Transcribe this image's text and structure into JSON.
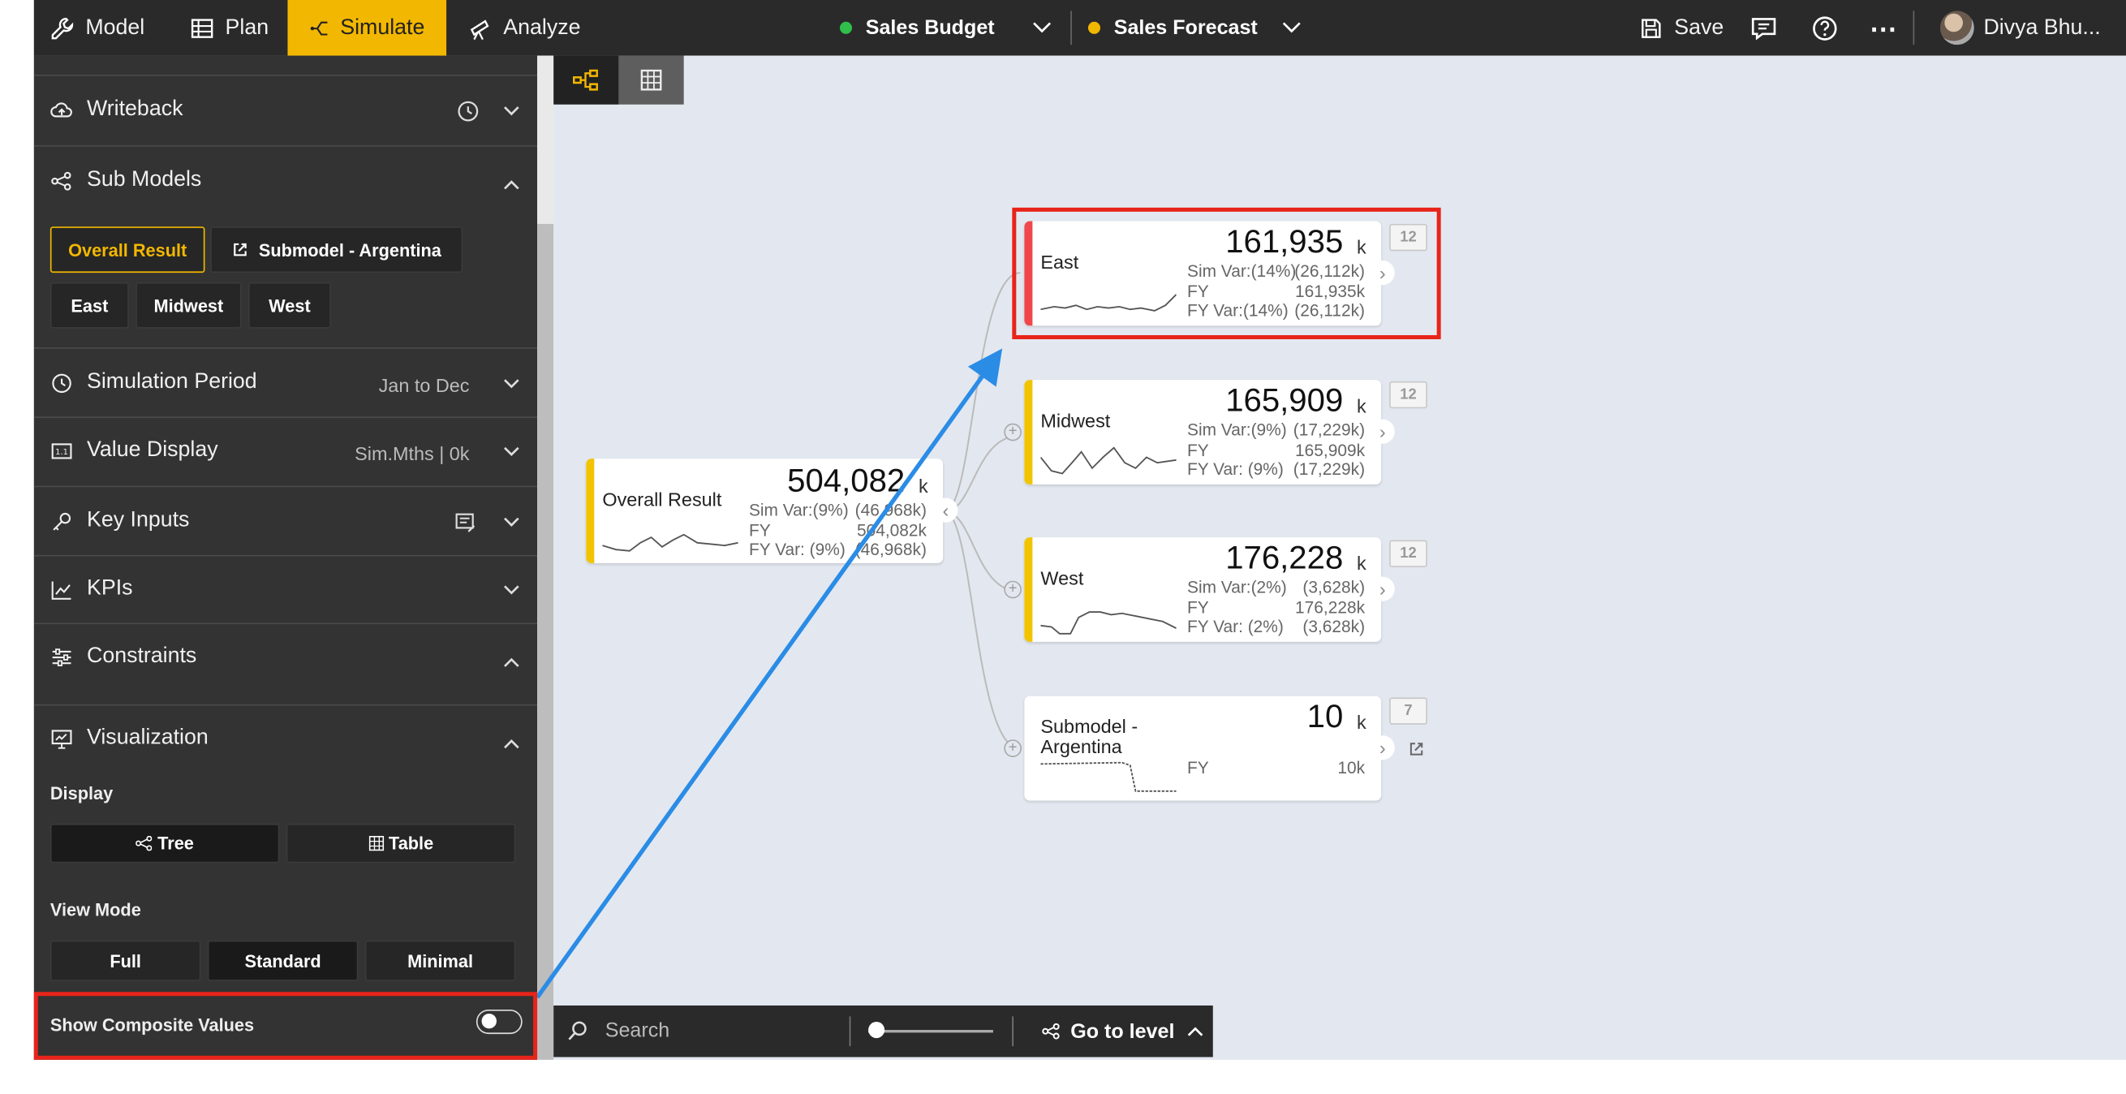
{
  "topbar": {
    "nav": [
      {
        "label": "Model",
        "icon": "wrench-icon"
      },
      {
        "label": "Plan",
        "icon": "table-icon"
      },
      {
        "label": "Simulate",
        "icon": "simulate-icon"
      },
      {
        "label": "Analyze",
        "icon": "telescope-icon"
      }
    ],
    "scenario1": {
      "label": "Sales Budget",
      "color": "#2fbf4a"
    },
    "scenario2": {
      "label": "Sales Forecast",
      "color": "#f2b700"
    },
    "save_label": "Save",
    "user_name": "Divya Bhu..."
  },
  "sidebar": {
    "writeback": {
      "label": "Writeback"
    },
    "submodels": {
      "label": "Sub Models",
      "buttons": [
        "Overall Result",
        "Submodel - Argentina",
        "East",
        "Midwest",
        "West"
      ]
    },
    "simulation_period": {
      "label": "Simulation Period",
      "value": "Jan to Dec"
    },
    "value_display": {
      "label": "Value Display",
      "value": "Sim.Mths | 0k"
    },
    "key_inputs": {
      "label": "Key Inputs"
    },
    "kpis": {
      "label": "KPIs"
    },
    "constraints": {
      "label": "Constraints"
    },
    "visualization": {
      "label": "Visualization",
      "display_label": "Display",
      "display_options": [
        "Tree",
        "Table"
      ],
      "view_mode_label": "View Mode",
      "view_modes": [
        "Full",
        "Standard",
        "Minimal"
      ],
      "selected_view_mode": "Standard",
      "composite_label": "Show Composite Values",
      "composite_on": false
    }
  },
  "nodes": {
    "overall": {
      "name": "Overall Result",
      "value": "504,082",
      "unit": "k",
      "metrics_left": [
        "Sim Var:(9%)",
        "FY",
        "FY Var:  (9%)"
      ],
      "metrics_right": [
        "(46,968k)",
        "504,082k",
        "(46,968k)"
      ],
      "bar_color": "#f2c400"
    },
    "east": {
      "name": "East",
      "value": "161,935",
      "unit": "k",
      "metrics_left": [
        "Sim Var:(14%)",
        "FY",
        "FY Var:(14%)"
      ],
      "metrics_right": [
        "(26,112k)",
        "161,935k",
        "(26,112k)"
      ],
      "bar_color": "#f0474c",
      "badge": "12"
    },
    "midwest": {
      "name": "Midwest",
      "value": "165,909",
      "unit": "k",
      "metrics_left": [
        "Sim Var:(9%)",
        "FY",
        "FY Var:  (9%)"
      ],
      "metrics_right": [
        "(17,229k)",
        "165,909k",
        "(17,229k)"
      ],
      "bar_color": "#f2c400",
      "badge": "12"
    },
    "west": {
      "name": "West",
      "value": "176,228",
      "unit": "k",
      "metrics_left": [
        "Sim Var:(2%)",
        "FY",
        "FY Var:  (2%)"
      ],
      "metrics_right": [
        "(3,628k)",
        "176,228k",
        "(3,628k)"
      ],
      "bar_color": "#f2c400",
      "badge": "12"
    },
    "argentina": {
      "name": "Submodel - Argentina",
      "value": "10",
      "unit": "k",
      "metrics_left": [
        "FY"
      ],
      "metrics_right": [
        "10k"
      ],
      "badge": "7"
    }
  },
  "bottombar": {
    "search_placeholder": "Search",
    "zoom_level": 0.05,
    "goto_label": "Go to level"
  },
  "colors": {
    "accent": "#f2b700",
    "highlight": "#e8241a",
    "arrow": "#2b8ce6",
    "sidebar_bg": "#333333",
    "canvas_bg": "#e3e8f0"
  }
}
